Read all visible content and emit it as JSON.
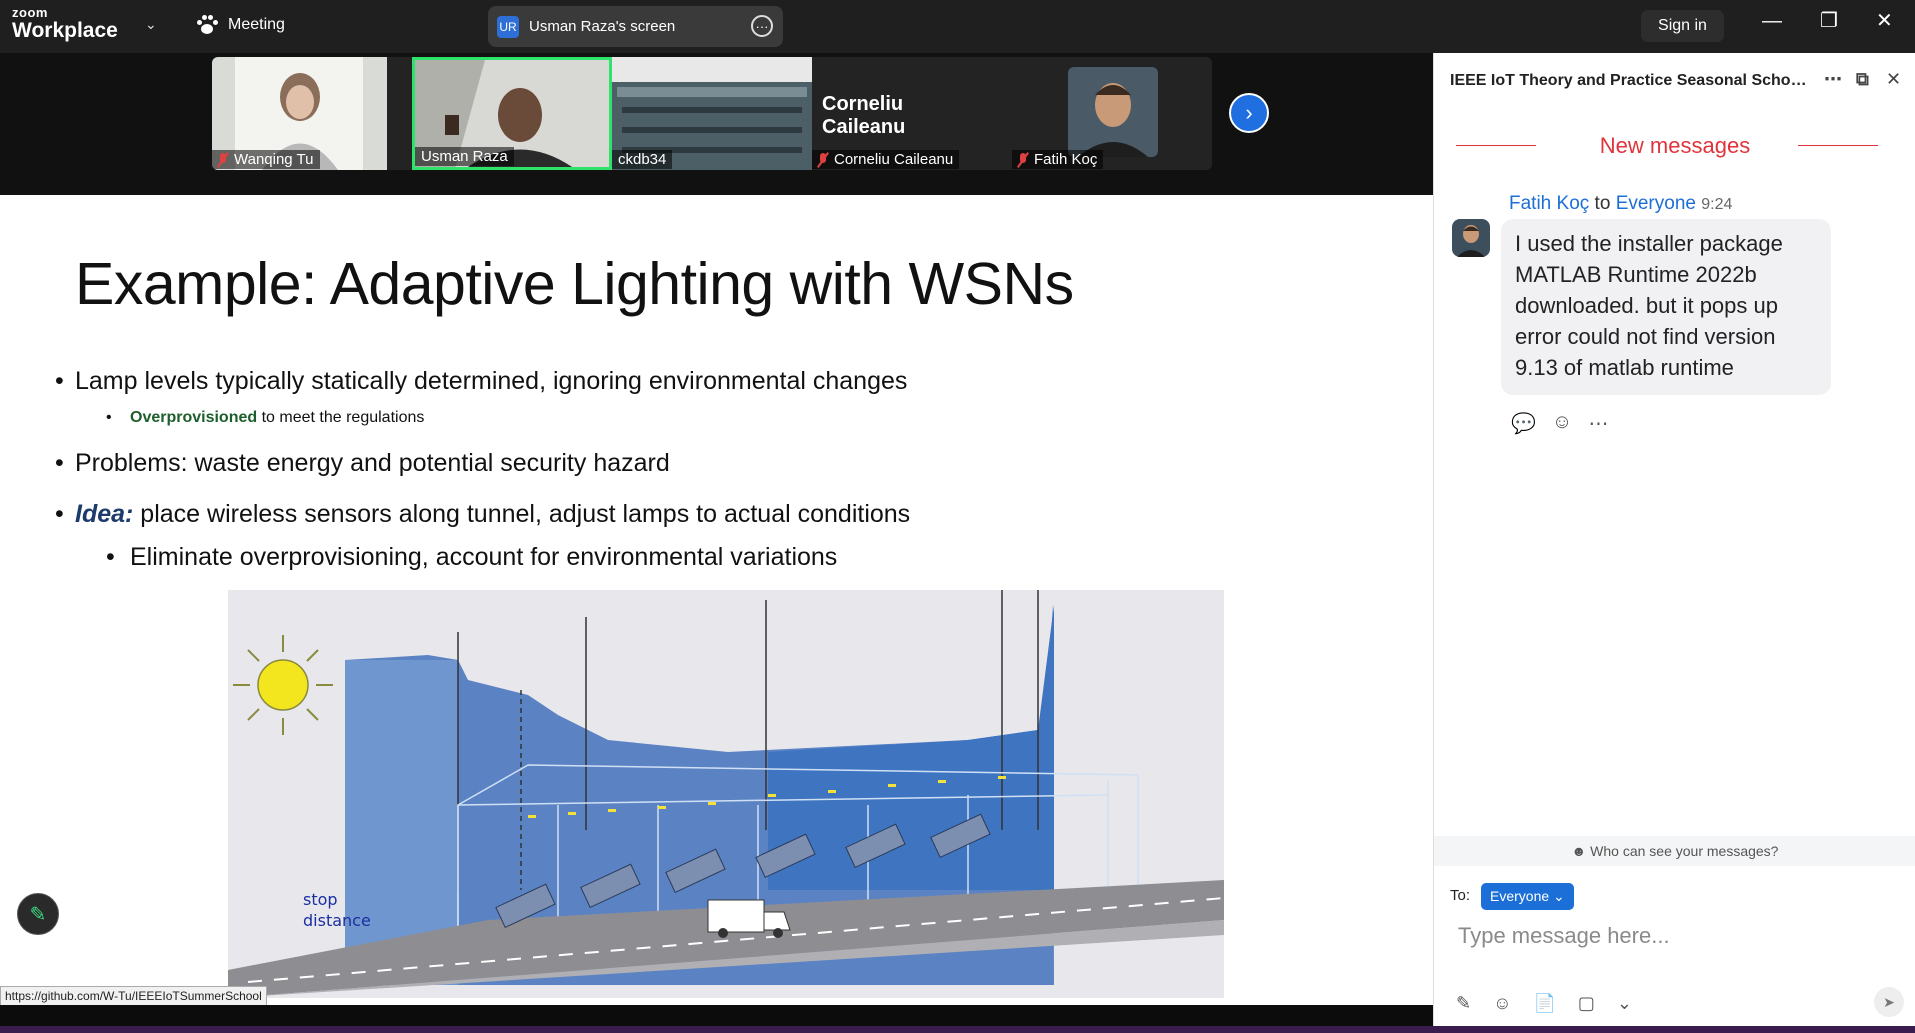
{
  "topbar": {
    "logo_zoom": "zoom",
    "logo_workplace": "Workplace",
    "meeting_label": "Meeting",
    "screen_initials": "UR",
    "screen_label": "Usman Raza's screen",
    "sign_in": "Sign in"
  },
  "participants": [
    {
      "name": "Wanqing Tu",
      "muted": true
    },
    {
      "name": "Usman Raza",
      "muted": false,
      "active_speaker": true
    },
    {
      "name": "ckdb34",
      "muted": false
    },
    {
      "name": "Corneliu Caileanu",
      "muted": true,
      "big_label": "Corneliu Caileanu"
    },
    {
      "name": "Fatih Koç",
      "muted": true
    }
  ],
  "slide": {
    "title": "Example: Adaptive Lighting with WSNs",
    "bullet1": "Lamp levels typically statically determined, ignoring environmental changes",
    "sub1_highlight": "Overprovisioned",
    "sub1_rest": " to meet the regulations",
    "bullet2": "Problems: waste energy and potential security hazard",
    "bullet3_label": "Idea:",
    "bullet3_rest": " place wireless sensors along tunnel, adjust lamps to actual conditions",
    "sub3": "Eliminate overprovisioning, account for environmental variations",
    "diagram_label_line1": "stop",
    "diagram_label_line2": "distance"
  },
  "status_url": "https://github.com/W-Tu/IEEEIoTSummerSchool",
  "chat": {
    "title": "IEEE IoT Theory and Practice Seasonal Schoo...",
    "new_messages": "New messages",
    "message": {
      "sender": "Fatih Koç",
      "to_word": "to",
      "recipient": "Everyone",
      "time": "9:24",
      "text": "I used the installer package MATLAB Runtime 2022b downloaded. but it pops up error could not find version 9.13 of matlab runtime"
    },
    "who_can_see": "Who can see your messages?",
    "to_label": "To:",
    "to_value": "Everyone",
    "placeholder": "Type message here..."
  },
  "colors": {
    "accent": "#1c6fd6",
    "new_messages": "#e0343c",
    "active_speaker_border": "#2ee26a"
  }
}
